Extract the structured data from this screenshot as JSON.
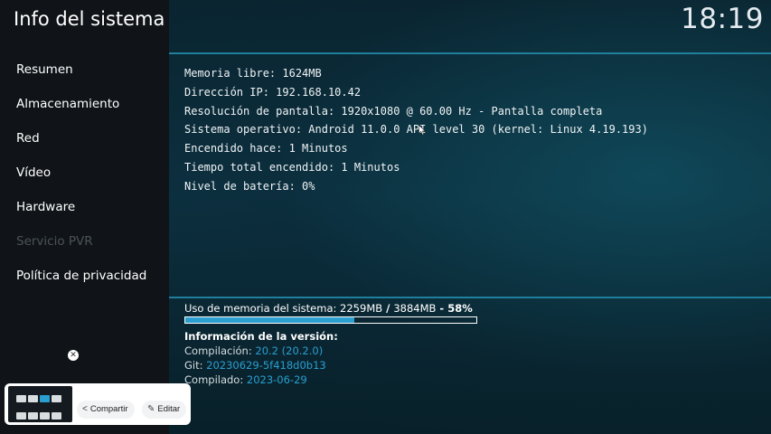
{
  "header": {
    "title": "Info del sistema",
    "clock": "18:19"
  },
  "sidebar": {
    "items": [
      {
        "label": "Resumen",
        "disabled": false
      },
      {
        "label": "Almacenamiento",
        "disabled": false
      },
      {
        "label": "Red",
        "disabled": false
      },
      {
        "label": "Vídeo",
        "disabled": false
      },
      {
        "label": "Hardware",
        "disabled": false
      },
      {
        "label": "Servicio PVR",
        "disabled": true
      },
      {
        "label": "Política de privacidad",
        "disabled": false
      }
    ]
  },
  "info": {
    "lines": [
      "Memoria libre: 1624MB",
      "Dirección IP: 192.168.10.42",
      "Resolución de pantalla: 1920x1080 @ 60.00 Hz - Pantalla completa",
      "Sistema operativo: Android 11.0.0 API level 30 (kernel: Linux 4.19.193)",
      "Encendido hace: 1 Minutos",
      "Tiempo total encendido: 1 Minutos",
      "Nivel de batería: 0%"
    ]
  },
  "memory": {
    "label_prefix": "Uso de memoria del sistema: ",
    "used": "2259MB",
    "separator": " / ",
    "total": "3884MB",
    "percent_text": " - 58%",
    "usage_fraction": 0.58
  },
  "version": {
    "heading": "Información de la versión:",
    "rows": [
      {
        "key": "Compilación: ",
        "value": "20.2 (20.2.0)"
      },
      {
        "key": "Git: ",
        "value": "20230629-5f418d0b13"
      },
      {
        "key": "Compilado: ",
        "value": "2023-06-29"
      }
    ]
  },
  "share_bar": {
    "share_label": "Compartir",
    "edit_label": "Editar"
  },
  "colors": {
    "accent": "#2a9fd0",
    "divider": "#1f7f9c",
    "sidebar_bg": "#101418"
  }
}
